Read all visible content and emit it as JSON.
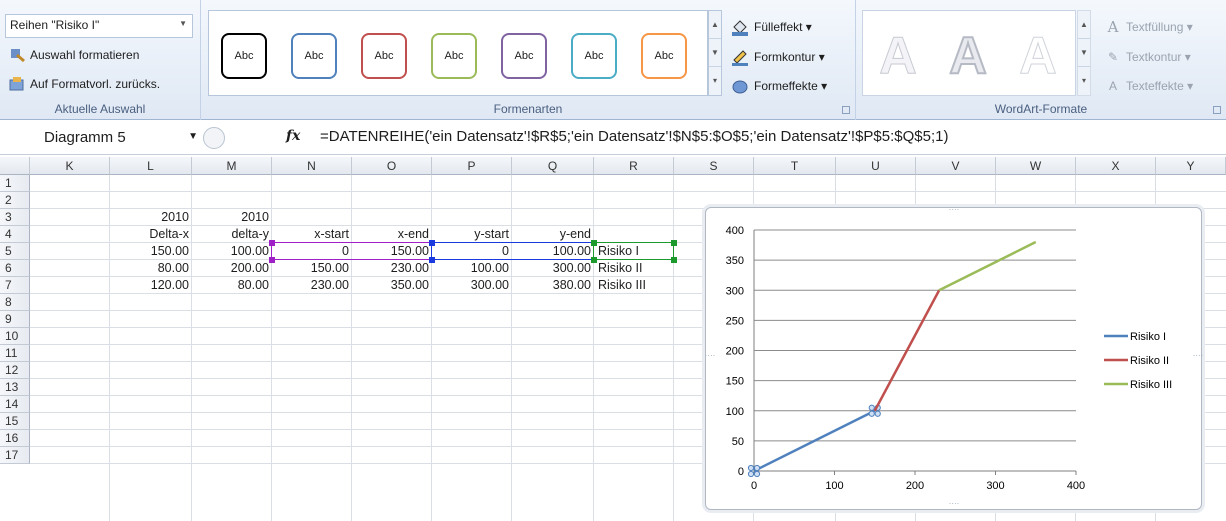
{
  "ribbon": {
    "current_selection": {
      "dropdown_value": "Reihen \"Risiko I\"",
      "format_selection": "Auswahl formatieren",
      "reset_style": "Auf Formatvorl. zurücks.",
      "label": "Aktuelle Auswahl"
    },
    "shape_styles": {
      "label": "Formenarten",
      "buttons": [
        {
          "text": "Abc",
          "color": "#000000"
        },
        {
          "text": "Abc",
          "color": "#4f81bd"
        },
        {
          "text": "Abc",
          "color": "#c0504d"
        },
        {
          "text": "Abc",
          "color": "#9bbb59"
        },
        {
          "text": "Abc",
          "color": "#8064a2"
        },
        {
          "text": "Abc",
          "color": "#4bacc6"
        },
        {
          "text": "Abc",
          "color": "#f79646"
        }
      ],
      "fill": "Fülleffekt",
      "outline": "Formkontur",
      "effects": "Formeffekte"
    },
    "wordart": {
      "label": "WordArt-Formate",
      "text_fill": "Textfüllung",
      "text_outline": "Textkontur",
      "text_effects": "Texteffekte",
      "letter": "A"
    }
  },
  "formula_bar": {
    "name_box": "Diagramm 5",
    "fx": "fx",
    "formula": "=DATENREIHE('ein Datensatz'!$R$5;'ein Datensatz'!$N$5:$O$5;'ein Datensatz'!$P$5:$Q$5;1)"
  },
  "sheet": {
    "columns": [
      "K",
      "L",
      "M",
      "N",
      "O",
      "P",
      "Q",
      "R",
      "S",
      "T",
      "U",
      "V",
      "W",
      "X",
      "Y"
    ],
    "rows": [
      "1",
      "2",
      "3",
      "4",
      "5",
      "6",
      "7",
      "8",
      "9",
      "10",
      "11",
      "12",
      "13",
      "14",
      "15",
      "16",
      "17"
    ],
    "cells": {
      "L3": "2010",
      "M3": "2010",
      "L4": "Delta-x",
      "M4": "delta-y",
      "N4": "x-start",
      "O4": "x-end",
      "P4": "y-start",
      "Q4": "y-end",
      "L5": "150.00",
      "M5": "100.00",
      "N5": "0",
      "O5": "150.00",
      "P5": "0",
      "Q5": "100.00",
      "R5": "Risiko I",
      "L6": "80.00",
      "M6": "200.00",
      "N6": "150.00",
      "O6": "230.00",
      "P6": "100.00",
      "Q6": "300.00",
      "R6": "Risiko II",
      "L7": "120.00",
      "M7": "80.00",
      "N7": "230.00",
      "O7": "350.00",
      "P7": "300.00",
      "Q7": "380.00",
      "R7": "Risiko III"
    }
  },
  "chart_data": {
    "type": "line",
    "xlim": [
      0,
      400
    ],
    "ylim": [
      0,
      400
    ],
    "xticks": [
      0,
      100,
      200,
      300,
      400
    ],
    "yticks": [
      0,
      50,
      100,
      150,
      200,
      250,
      300,
      350,
      400
    ],
    "grid": "horizontal",
    "legend_position": "right",
    "series": [
      {
        "name": "Risiko I",
        "color": "#4f81bd",
        "x": [
          0,
          150
        ],
        "y": [
          0,
          100
        ],
        "selected": true
      },
      {
        "name": "Risiko II",
        "color": "#c0504d",
        "x": [
          150,
          230
        ],
        "y": [
          100,
          300
        ]
      },
      {
        "name": "Risiko III",
        "color": "#9bbb59",
        "x": [
          230,
          350
        ],
        "y": [
          300,
          380
        ]
      }
    ]
  }
}
